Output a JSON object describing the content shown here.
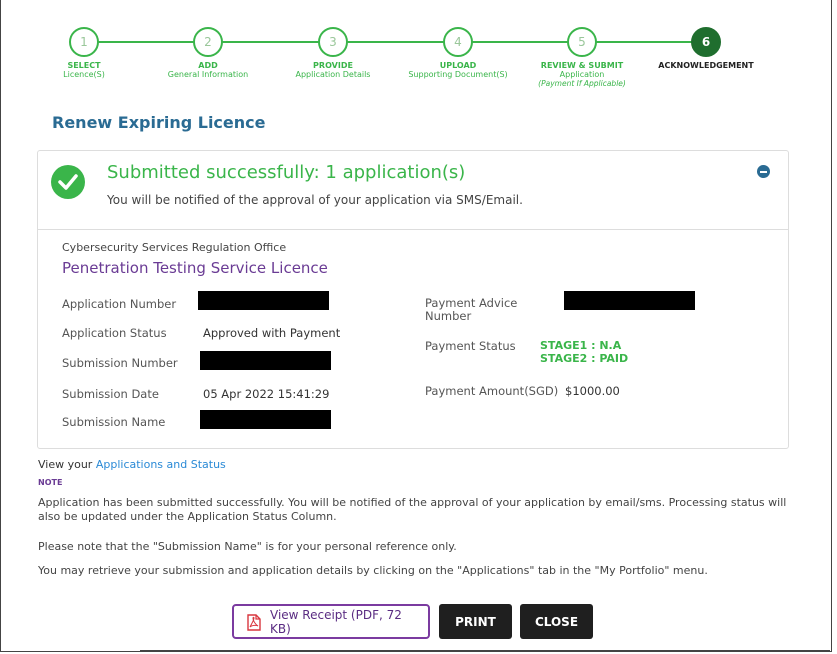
{
  "stepper": {
    "steps": [
      {
        "number": "1",
        "label": "SELECT",
        "sub": "Licence(S)",
        "note": ""
      },
      {
        "number": "2",
        "label": "ADD",
        "sub": "General Information",
        "note": ""
      },
      {
        "number": "3",
        "label": "PROVIDE",
        "sub": "Application Details",
        "note": ""
      },
      {
        "number": "4",
        "label": "UPLOAD",
        "sub": "Supporting Document(S)",
        "note": ""
      },
      {
        "number": "5",
        "label": "REVIEW & SUBMIT",
        "sub": "Application",
        "note": "(Payment If Applicable)"
      },
      {
        "number": "6",
        "label": "ACKNOWLEDGEMENT",
        "sub": "",
        "note": ""
      }
    ],
    "accent_color": "#3ab54a",
    "active_color": "#1f6e2e"
  },
  "page": {
    "title": "Renew Expiring Licence"
  },
  "result": {
    "title": "Submitted successfully: 1 application(s)",
    "message": "You will be notified of the approval of your application via SMS/Email."
  },
  "application": {
    "office": "Cybersecurity Services Regulation Office",
    "licence": "Penetration Testing Service Licence",
    "labels": {
      "application_number": "Application Number",
      "application_status": "Application Status",
      "submission_number": "Submission Number",
      "submission_date": "Submission Date",
      "submission_name": "Submission Name",
      "payment_advice_number": "Payment Advice Number",
      "payment_status": "Payment Status",
      "payment_amount": "Payment Amount(SGD)"
    },
    "application_status": "Approved with Payment",
    "submission_date": "05 Apr 2022 15:41:29",
    "payment_status_stage1": "STAGE1 : N.A",
    "payment_status_stage2": "STAGE2 : PAID",
    "payment_amount": "$1000.00"
  },
  "footer": {
    "view_prefix": "View your",
    "view_link": "Applications and Status",
    "note_label": "NOTE",
    "notes": [
      "Application has been submitted successfully. You will be notified of the approval of your application by email/sms. Processing status will also be updated under the Application Status Column.",
      "Please note that the \"Submission Name\" is for your personal reference only.",
      "You may retrieve your submission and application details by clicking on the \"Applications\" tab in the \"My Portfolio\" menu."
    ]
  },
  "buttons": {
    "receipt": "View Receipt (PDF, 72 KB)",
    "print": "PRINT",
    "close": "CLOSE"
  }
}
